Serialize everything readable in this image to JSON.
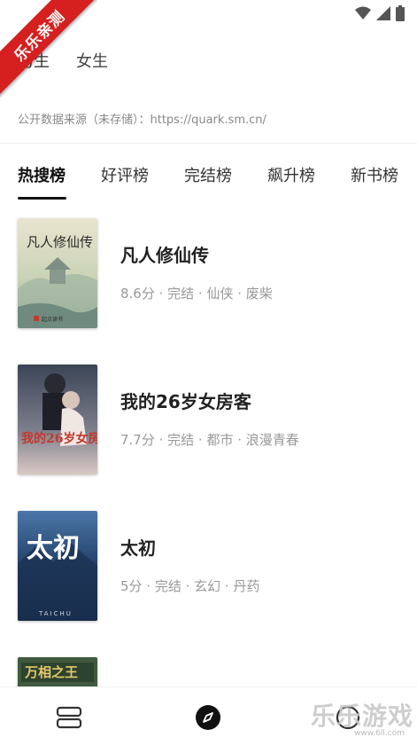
{
  "watermark": {
    "ribbon": "乐乐亲测",
    "logo": "乐乐游戏",
    "url": "www.6ll.com"
  },
  "gender_tabs": [
    {
      "label": "男生"
    },
    {
      "label": "女生"
    }
  ],
  "source_note": "公开数据来源（未存储）：https://quark.sm.cn/",
  "rank_tabs": [
    {
      "label": "热搜榜",
      "active": true
    },
    {
      "label": "好评榜"
    },
    {
      "label": "完结榜"
    },
    {
      "label": "飙升榜"
    },
    {
      "label": "新书榜"
    }
  ],
  "books": [
    {
      "title": "凡人修仙传",
      "meta": "8.6分 · 完结 · 仙侠 · 废柴",
      "cover_text": "凡人修仙传",
      "cover_publisher": "起点读书"
    },
    {
      "title": "我的26岁女房客",
      "meta": "7.7分 · 完结 · 都市 · 浪漫青春",
      "cover_text": "我的26岁女房客"
    },
    {
      "title": "太初",
      "meta": "5分 · 完结 · 玄幻 · 丹药",
      "cover_text": "太初",
      "cover_sub": "TAICHU"
    },
    {
      "title": "",
      "meta": "",
      "cover_text": "万相之王"
    }
  ],
  "icons": {
    "status": [
      "wifi-icon",
      "signal-icon",
      "battery-icon"
    ],
    "nav": [
      "bookshelf-icon",
      "discover-icon",
      "profile-icon"
    ]
  },
  "colors": {
    "ribbon": "#d61f1f",
    "active_tab": "#111111",
    "meta_text": "#999999"
  }
}
